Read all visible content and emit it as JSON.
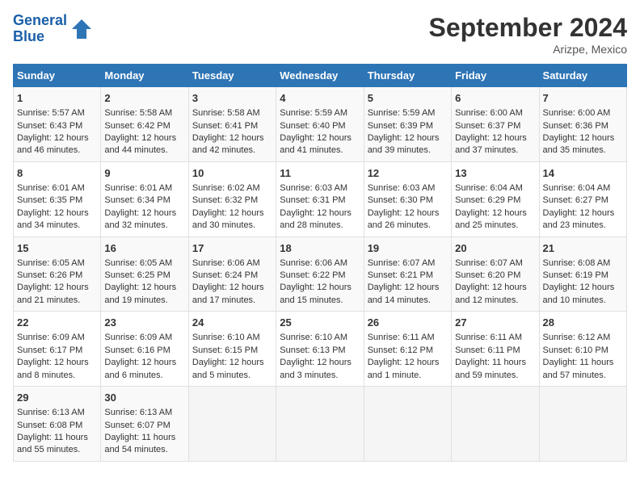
{
  "header": {
    "logo_line1": "General",
    "logo_line2": "Blue",
    "month_title": "September 2024",
    "location": "Arizpe, Mexico"
  },
  "columns": [
    "Sunday",
    "Monday",
    "Tuesday",
    "Wednesday",
    "Thursday",
    "Friday",
    "Saturday"
  ],
  "weeks": [
    [
      {
        "day": "1",
        "lines": [
          "Sunrise: 5:57 AM",
          "Sunset: 6:43 PM",
          "Daylight: 12 hours",
          "and 46 minutes."
        ]
      },
      {
        "day": "2",
        "lines": [
          "Sunrise: 5:58 AM",
          "Sunset: 6:42 PM",
          "Daylight: 12 hours",
          "and 44 minutes."
        ]
      },
      {
        "day": "3",
        "lines": [
          "Sunrise: 5:58 AM",
          "Sunset: 6:41 PM",
          "Daylight: 12 hours",
          "and 42 minutes."
        ]
      },
      {
        "day": "4",
        "lines": [
          "Sunrise: 5:59 AM",
          "Sunset: 6:40 PM",
          "Daylight: 12 hours",
          "and 41 minutes."
        ]
      },
      {
        "day": "5",
        "lines": [
          "Sunrise: 5:59 AM",
          "Sunset: 6:39 PM",
          "Daylight: 12 hours",
          "and 39 minutes."
        ]
      },
      {
        "day": "6",
        "lines": [
          "Sunrise: 6:00 AM",
          "Sunset: 6:37 PM",
          "Daylight: 12 hours",
          "and 37 minutes."
        ]
      },
      {
        "day": "7",
        "lines": [
          "Sunrise: 6:00 AM",
          "Sunset: 6:36 PM",
          "Daylight: 12 hours",
          "and 35 minutes."
        ]
      }
    ],
    [
      {
        "day": "8",
        "lines": [
          "Sunrise: 6:01 AM",
          "Sunset: 6:35 PM",
          "Daylight: 12 hours",
          "and 34 minutes."
        ]
      },
      {
        "day": "9",
        "lines": [
          "Sunrise: 6:01 AM",
          "Sunset: 6:34 PM",
          "Daylight: 12 hours",
          "and 32 minutes."
        ]
      },
      {
        "day": "10",
        "lines": [
          "Sunrise: 6:02 AM",
          "Sunset: 6:32 PM",
          "Daylight: 12 hours",
          "and 30 minutes."
        ]
      },
      {
        "day": "11",
        "lines": [
          "Sunrise: 6:03 AM",
          "Sunset: 6:31 PM",
          "Daylight: 12 hours",
          "and 28 minutes."
        ]
      },
      {
        "day": "12",
        "lines": [
          "Sunrise: 6:03 AM",
          "Sunset: 6:30 PM",
          "Daylight: 12 hours",
          "and 26 minutes."
        ]
      },
      {
        "day": "13",
        "lines": [
          "Sunrise: 6:04 AM",
          "Sunset: 6:29 PM",
          "Daylight: 12 hours",
          "and 25 minutes."
        ]
      },
      {
        "day": "14",
        "lines": [
          "Sunrise: 6:04 AM",
          "Sunset: 6:27 PM",
          "Daylight: 12 hours",
          "and 23 minutes."
        ]
      }
    ],
    [
      {
        "day": "15",
        "lines": [
          "Sunrise: 6:05 AM",
          "Sunset: 6:26 PM",
          "Daylight: 12 hours",
          "and 21 minutes."
        ]
      },
      {
        "day": "16",
        "lines": [
          "Sunrise: 6:05 AM",
          "Sunset: 6:25 PM",
          "Daylight: 12 hours",
          "and 19 minutes."
        ]
      },
      {
        "day": "17",
        "lines": [
          "Sunrise: 6:06 AM",
          "Sunset: 6:24 PM",
          "Daylight: 12 hours",
          "and 17 minutes."
        ]
      },
      {
        "day": "18",
        "lines": [
          "Sunrise: 6:06 AM",
          "Sunset: 6:22 PM",
          "Daylight: 12 hours",
          "and 15 minutes."
        ]
      },
      {
        "day": "19",
        "lines": [
          "Sunrise: 6:07 AM",
          "Sunset: 6:21 PM",
          "Daylight: 12 hours",
          "and 14 minutes."
        ]
      },
      {
        "day": "20",
        "lines": [
          "Sunrise: 6:07 AM",
          "Sunset: 6:20 PM",
          "Daylight: 12 hours",
          "and 12 minutes."
        ]
      },
      {
        "day": "21",
        "lines": [
          "Sunrise: 6:08 AM",
          "Sunset: 6:19 PM",
          "Daylight: 12 hours",
          "and 10 minutes."
        ]
      }
    ],
    [
      {
        "day": "22",
        "lines": [
          "Sunrise: 6:09 AM",
          "Sunset: 6:17 PM",
          "Daylight: 12 hours",
          "and 8 minutes."
        ]
      },
      {
        "day": "23",
        "lines": [
          "Sunrise: 6:09 AM",
          "Sunset: 6:16 PM",
          "Daylight: 12 hours",
          "and 6 minutes."
        ]
      },
      {
        "day": "24",
        "lines": [
          "Sunrise: 6:10 AM",
          "Sunset: 6:15 PM",
          "Daylight: 12 hours",
          "and 5 minutes."
        ]
      },
      {
        "day": "25",
        "lines": [
          "Sunrise: 6:10 AM",
          "Sunset: 6:13 PM",
          "Daylight: 12 hours",
          "and 3 minutes."
        ]
      },
      {
        "day": "26",
        "lines": [
          "Sunrise: 6:11 AM",
          "Sunset: 6:12 PM",
          "Daylight: 12 hours",
          "and 1 minute."
        ]
      },
      {
        "day": "27",
        "lines": [
          "Sunrise: 6:11 AM",
          "Sunset: 6:11 PM",
          "Daylight: 11 hours",
          "and 59 minutes."
        ]
      },
      {
        "day": "28",
        "lines": [
          "Sunrise: 6:12 AM",
          "Sunset: 6:10 PM",
          "Daylight: 11 hours",
          "and 57 minutes."
        ]
      }
    ],
    [
      {
        "day": "29",
        "lines": [
          "Sunrise: 6:13 AM",
          "Sunset: 6:08 PM",
          "Daylight: 11 hours",
          "and 55 minutes."
        ]
      },
      {
        "day": "30",
        "lines": [
          "Sunrise: 6:13 AM",
          "Sunset: 6:07 PM",
          "Daylight: 11 hours",
          "and 54 minutes."
        ]
      },
      {
        "day": "",
        "lines": []
      },
      {
        "day": "",
        "lines": []
      },
      {
        "day": "",
        "lines": []
      },
      {
        "day": "",
        "lines": []
      },
      {
        "day": "",
        "lines": []
      }
    ]
  ]
}
